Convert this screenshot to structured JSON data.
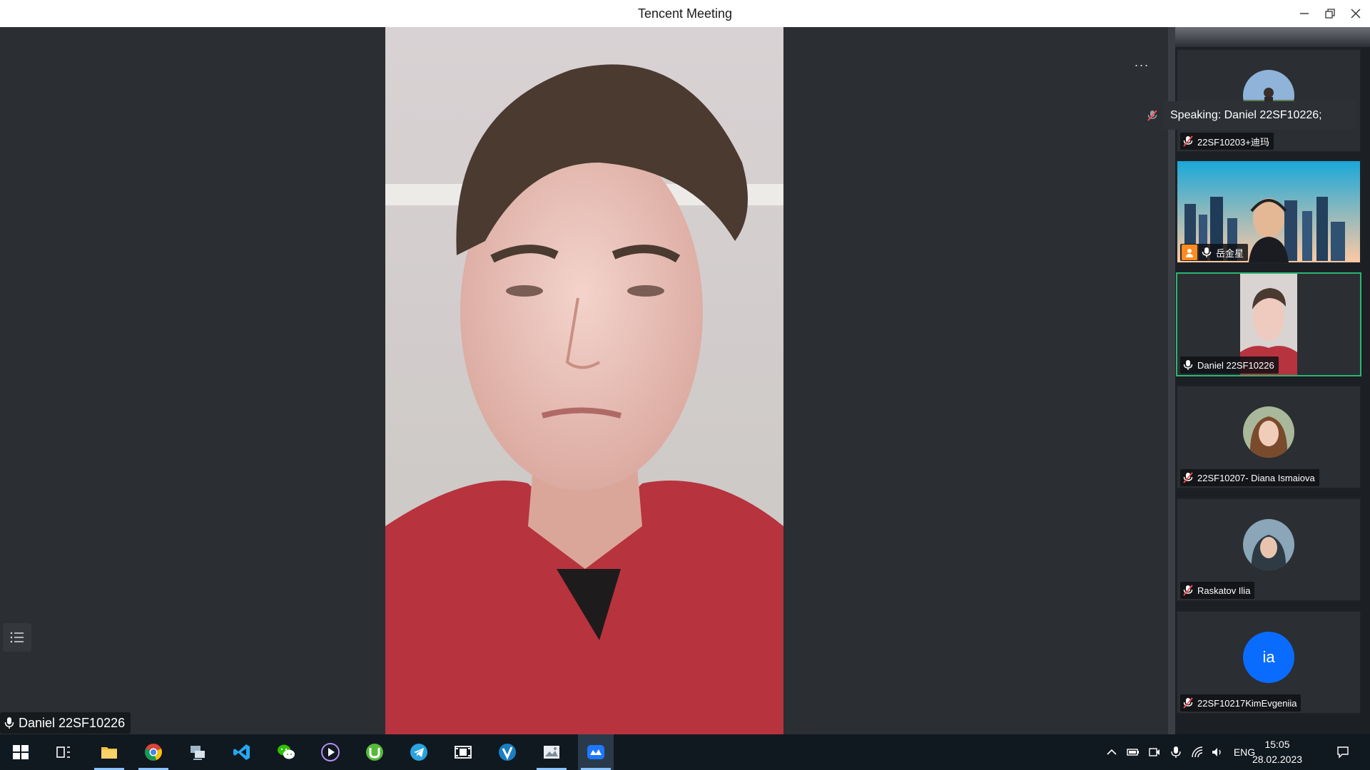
{
  "window": {
    "title": "Tencent Meeting",
    "minimize_icon": "minimize-icon",
    "restore_icon": "restore-icon",
    "close_icon": "close-icon"
  },
  "main": {
    "more_label": "···",
    "speaker_name": "Daniel 22SF10226"
  },
  "speaking_banner": "Speaking: Daniel 22SF10226;",
  "participants": [
    {
      "name": "22SF10203+迪玛",
      "muted": true,
      "video": false
    },
    {
      "name": "岳金星",
      "muted": false,
      "video": true,
      "host": true
    },
    {
      "name": "Daniel 22SF10226",
      "muted": false,
      "video": true,
      "active": true
    },
    {
      "name": "22SF10207- Diana Ismaiova",
      "muted": true,
      "video": false
    },
    {
      "name": "Raskatov Ilia",
      "muted": true,
      "video": false
    },
    {
      "name": "22SF10217KimEvgeniia",
      "muted": true,
      "video": false,
      "initials": "ia"
    }
  ],
  "taskbar": {
    "apps": [
      "windows-start-icon",
      "task-view-icon",
      "file-explorer-icon",
      "chrome-icon",
      "network-monitor-icon",
      "vscode-icon",
      "wechat-icon",
      "media-player-icon",
      "utorrent-icon",
      "telegram-icon",
      "video-editor-icon",
      "viber-like-icon",
      "photo-viewer-icon",
      "tencent-meeting-icon"
    ],
    "language": "ENG",
    "time": "15:05",
    "date": "28.02.2023"
  },
  "colors": {
    "accent_active": "#2bb673",
    "avatar_blue": "#0a6cff",
    "host_badge": "#ff8a1f",
    "background": "#2b2e33",
    "taskbar": "#101820"
  }
}
